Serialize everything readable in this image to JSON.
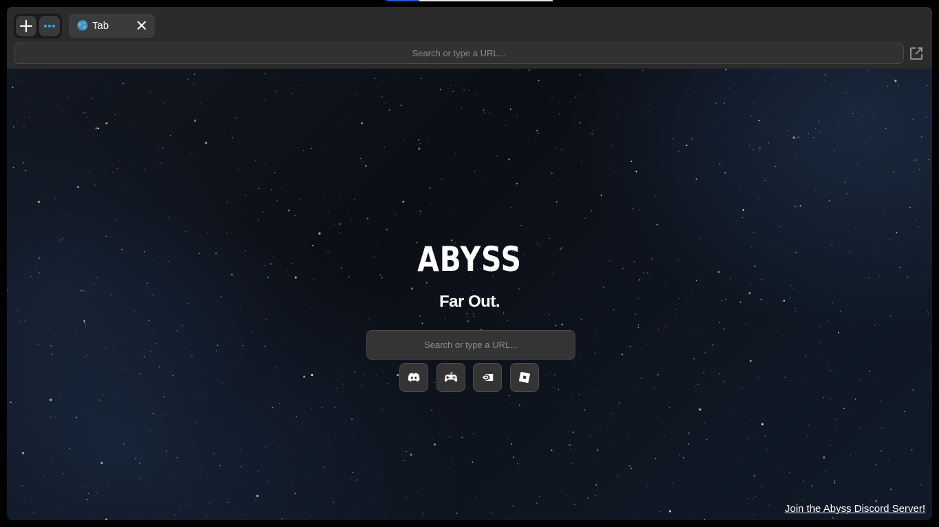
{
  "browser": {
    "tab": {
      "label": "Tab"
    },
    "address_bar": {
      "placeholder": "Search or type a URL..."
    }
  },
  "home": {
    "logo_text": "ABYSS",
    "tagline": "Far Out.",
    "search": {
      "placeholder": "Search or type a URL..."
    },
    "shortcuts": [
      {
        "name": "discord",
        "icon": "discord-icon"
      },
      {
        "name": "games",
        "icon": "gamepad-icon"
      },
      {
        "name": "geforce-now",
        "icon": "nvidia-icon"
      },
      {
        "name": "roblox",
        "icon": "roblox-icon"
      }
    ],
    "footer_link": "Join the Abyss Discord Server!"
  },
  "colors": {
    "accent_dots": "#2aa9f0",
    "chrome_bg": "#2b2b2b",
    "tab_bg": "#3b3b3b",
    "input_bg": "#343434"
  }
}
